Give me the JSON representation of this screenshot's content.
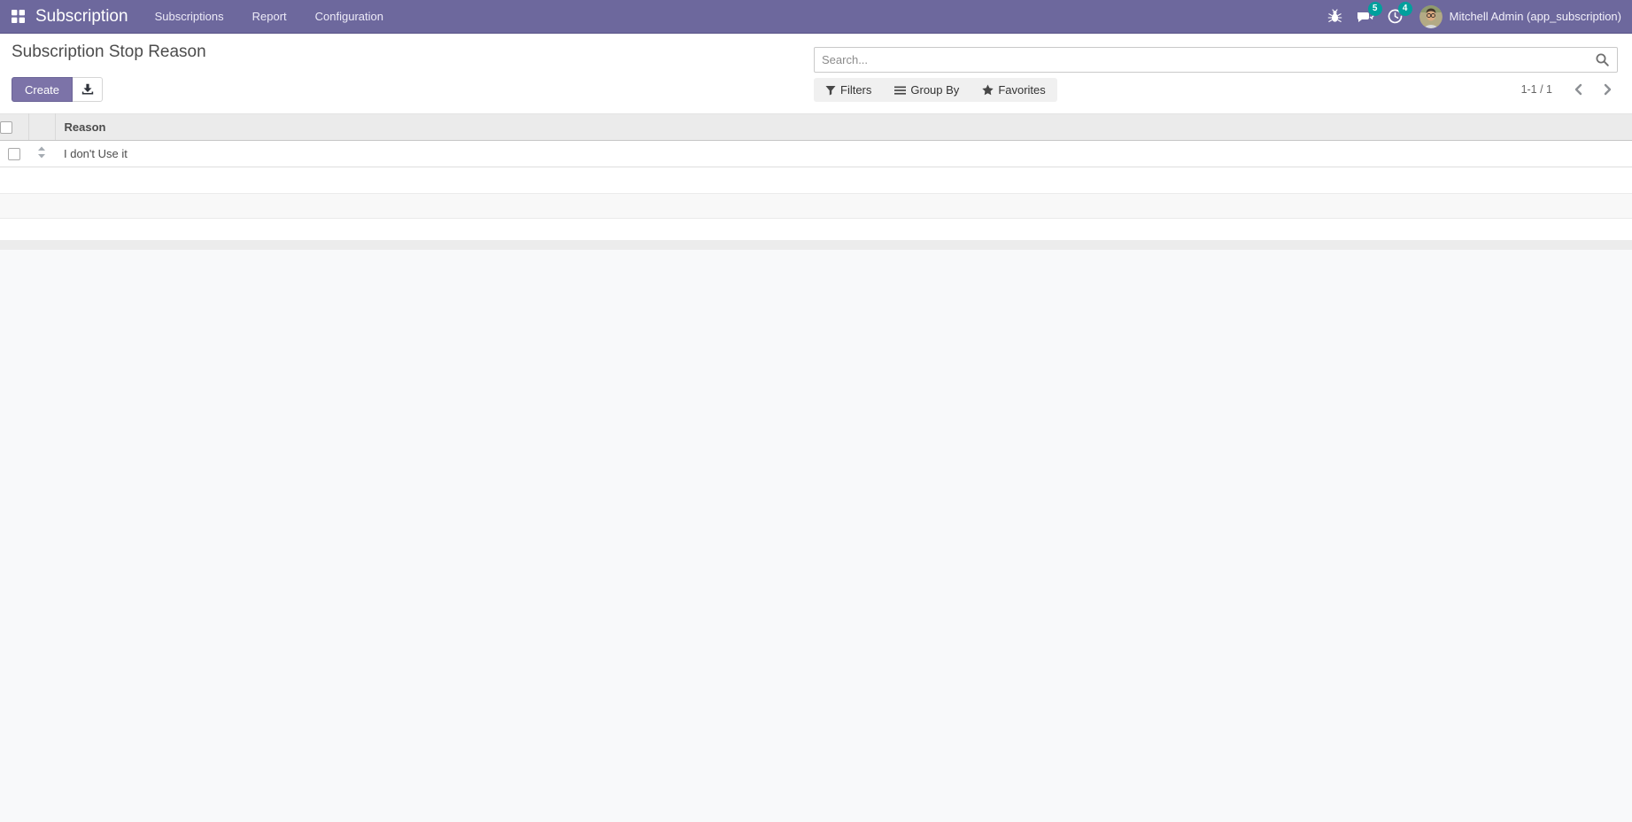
{
  "topbar": {
    "brand": "Subscription",
    "menus": [
      "Subscriptions",
      "Report",
      "Configuration"
    ],
    "message_badge": "5",
    "activity_badge": "4",
    "user_name": "Mitchell Admin (app_subscription)",
    "icons": [
      "apps-grid-icon",
      "bug-icon",
      "messages-icon",
      "activity-clock-icon",
      "avatar"
    ]
  },
  "control_panel": {
    "title": "Subscription Stop Reason",
    "create_label": "Create",
    "export_icon": "download-icon",
    "search_placeholder": "Search...",
    "filters_label": "Filters",
    "group_by_label": "Group By",
    "favorites_label": "Favorites",
    "pager_text": "1-1 / 1"
  },
  "table": {
    "header": "Reason",
    "rows": [
      "I don't Use it"
    ]
  },
  "colors": {
    "topbar_bg": "#6d689d",
    "accent_purple": "#7c73a8",
    "badge_teal": "#00a09d",
    "header_gray": "#ebebeb",
    "page_bg": "#f8f9fa"
  }
}
